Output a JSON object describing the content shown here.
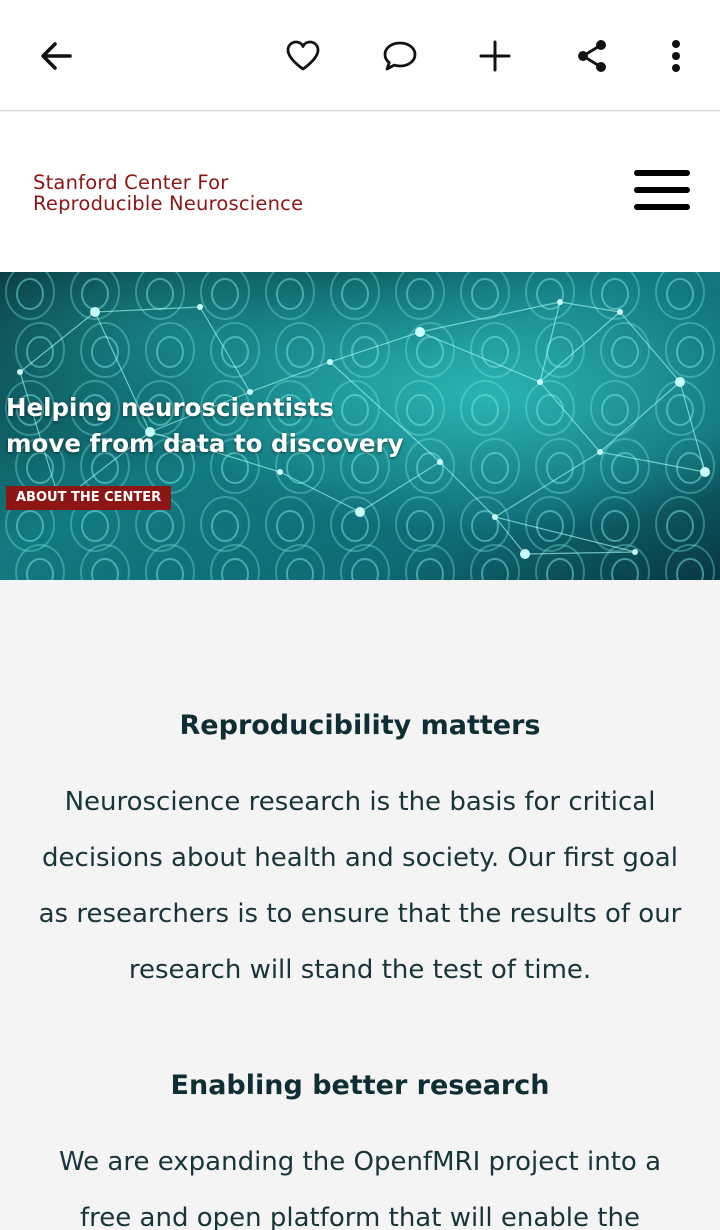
{
  "toolbar": {
    "icons": [
      "back-arrow-icon",
      "heart-icon",
      "comment-icon",
      "plus-icon",
      "share-icon",
      "more-vert-icon"
    ]
  },
  "header": {
    "logo_line1": "Stanford Center For",
    "logo_line2": "Reproducible Neuroscience",
    "logo_color": "#8c1515",
    "menu_icon": "hamburger-menu-icon"
  },
  "hero": {
    "title_line1": "Helping neuroscientists",
    "title_line2": "move from data to discovery",
    "button_label": "ABOUT THE CENTER",
    "button_color": "#8c1515",
    "image": "brain-scans-network-image"
  },
  "sections": [
    {
      "heading": "Reproducibility matters",
      "body": "Neuroscience research is the basis for critical decisions about health and society. Our first goal as researchers is to ensure that the results of our research will stand the test of time."
    },
    {
      "heading": "Enabling better research",
      "body": "We are expanding the OpenfMRI project into a free and open platform that will enable the"
    }
  ],
  "colors": {
    "heading": "#0f2e33",
    "page_background": "#f4f4f4"
  }
}
